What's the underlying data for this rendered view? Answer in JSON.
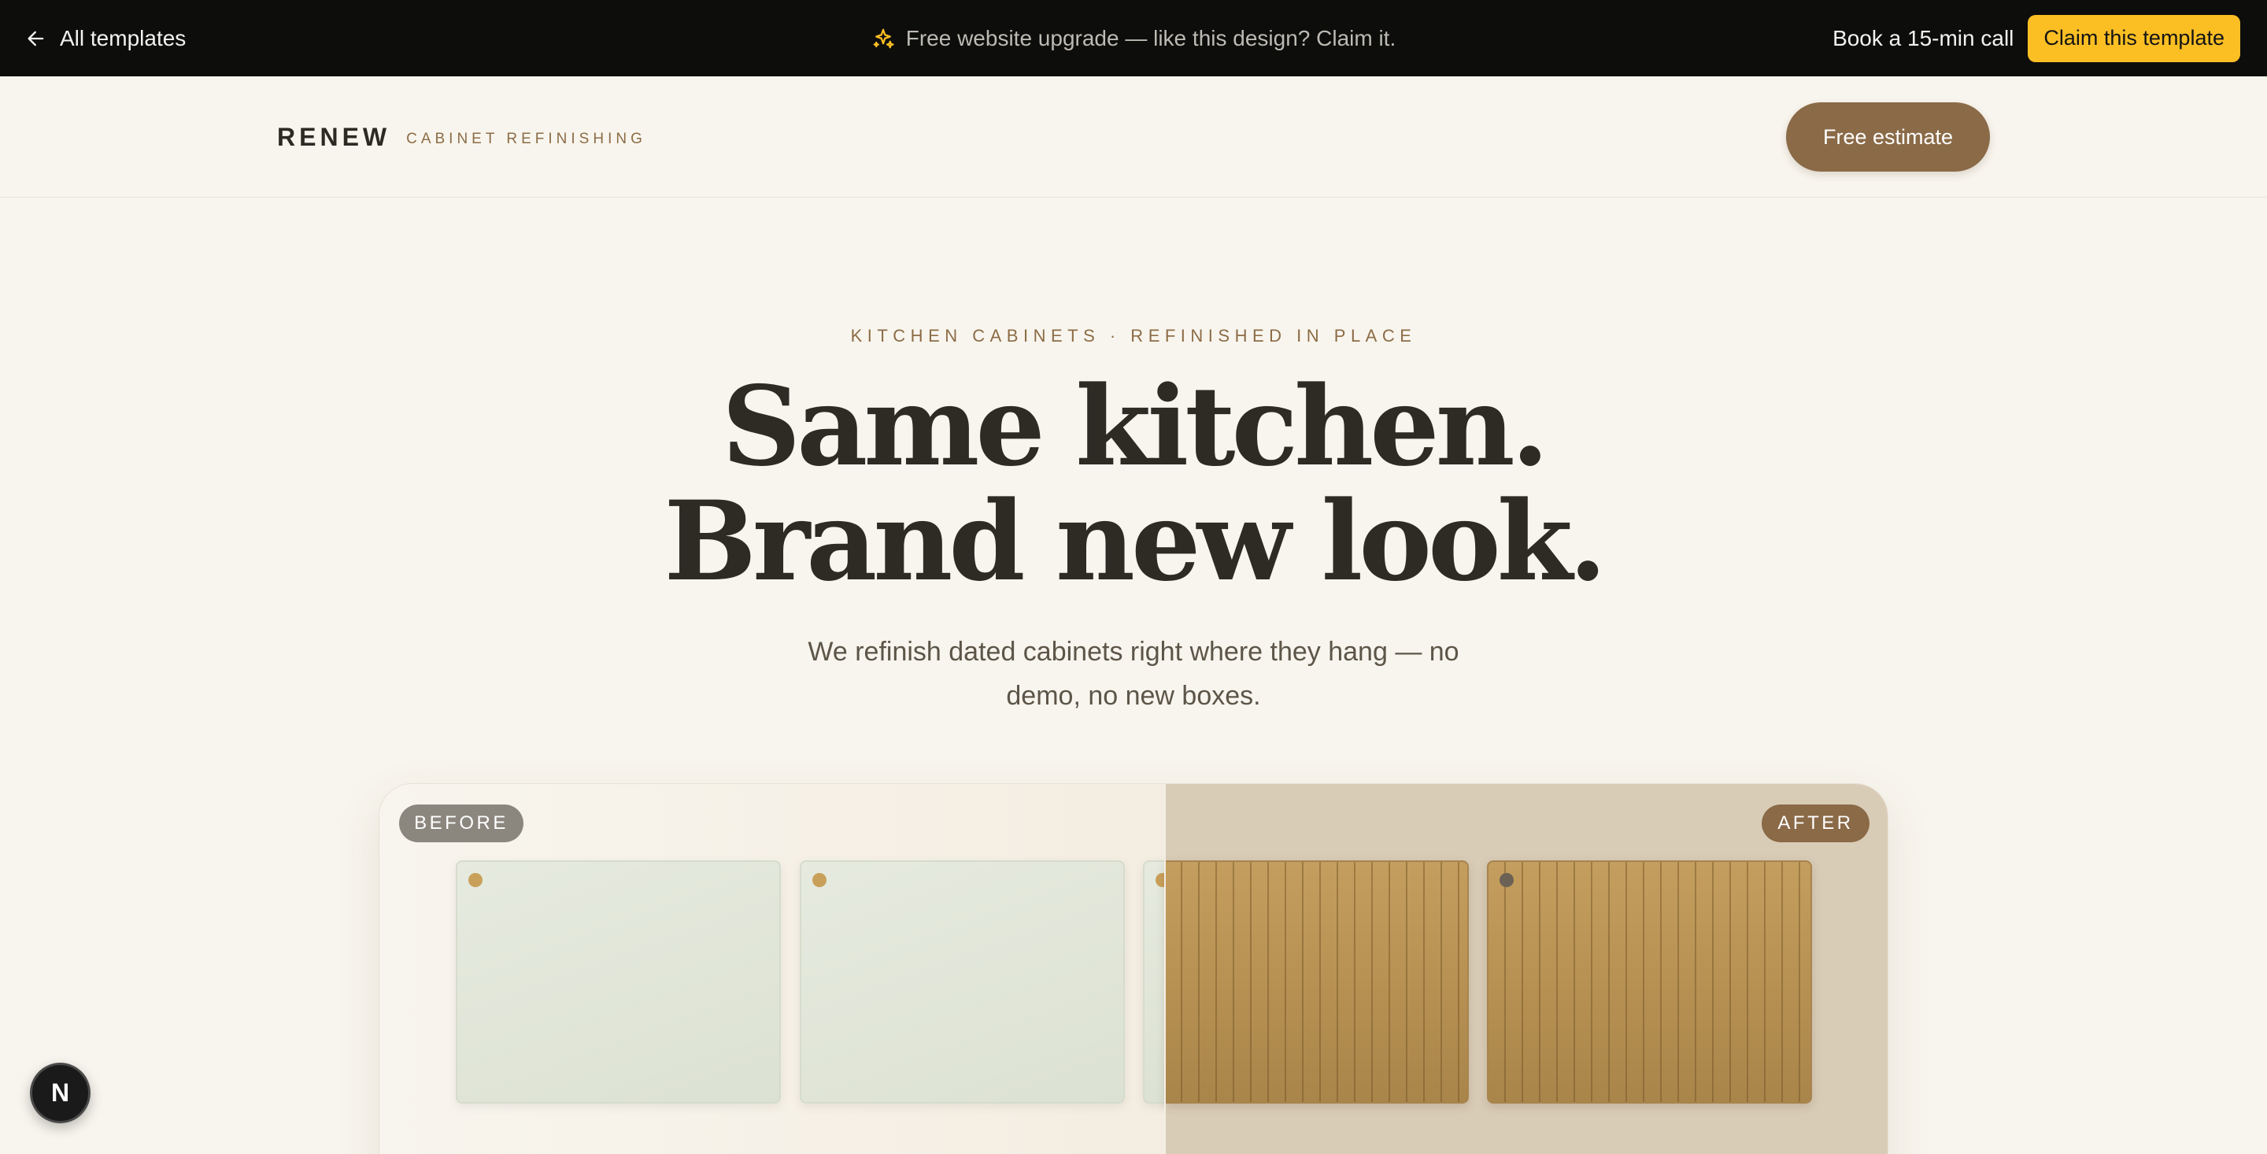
{
  "promo_bar": {
    "back_label": "All templates",
    "back_icon": "arrow-left-icon",
    "message": "Free website upgrade — like this design? Claim it.",
    "message_icon": "sparkle-icon",
    "book_call_label": "Book a 15-min call",
    "claim_label": "Claim this template",
    "accent_color": "#fbbf24"
  },
  "header": {
    "brand_name": "RENEW",
    "brand_tagline": "CABINET REFINISHING",
    "cta_label": "Free estimate",
    "cta_color": "#8a6a47"
  },
  "hero": {
    "eyebrow": "KITCHEN CABINETS · REFINISHED IN PLACE",
    "headline_line1": "Same kitchen.",
    "headline_line2": "Brand new look.",
    "subhead": "We refinish dated cabinets right where they hang — no demo, no new boxes."
  },
  "comparison": {
    "before_label": "BEFORE",
    "after_label": "AFTER",
    "before_color": "#e2e7da",
    "after_color": "#b8925a"
  },
  "floating_badge": {
    "letter": "N"
  }
}
